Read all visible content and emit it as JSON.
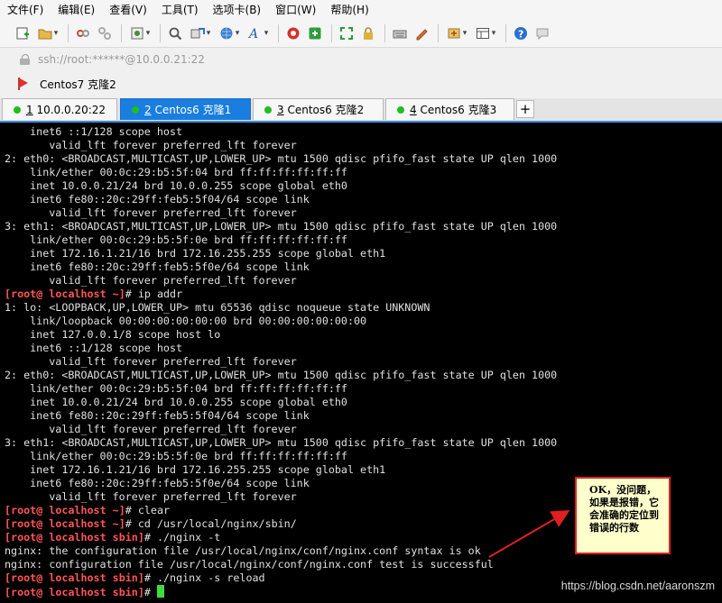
{
  "menu": [
    "文件(F)",
    "编辑(E)",
    "查看(V)",
    "工具(T)",
    "选项卡(B)",
    "窗口(W)",
    "帮助(H)"
  ],
  "address": "ssh://root:******@10.0.0.21:22",
  "session": "Centos7 克隆2",
  "tabs": [
    {
      "num": "1",
      "label": "10.0.0.20:22"
    },
    {
      "num": "2",
      "label": "Centos6 克隆1"
    },
    {
      "num": "3",
      "label": "Centos6 克隆2"
    },
    {
      "num": "4",
      "label": "Centos6 克隆3"
    }
  ],
  "active_tab_index": 1,
  "add_tab": "+",
  "prompt": {
    "user": "root",
    "host": "localhost"
  },
  "terminal_lines": [
    {
      "text": "    inet6 ::1/128 scope host "
    },
    {
      "text": "       valid_lft forever preferred_lft forever"
    },
    {
      "text": "2: eth0: <BROADCAST,MULTICAST,UP,LOWER_UP> mtu 1500 qdisc pfifo_fast state UP qlen 1000"
    },
    {
      "text": "    link/ether 00:0c:29:b5:5f:04 brd ff:ff:ff:ff:ff:ff"
    },
    {
      "text": "    inet 10.0.0.21/24 brd 10.0.0.255 scope global eth0"
    },
    {
      "text": "    inet6 fe80::20c:29ff:feb5:5f04/64 scope link "
    },
    {
      "text": "       valid_lft forever preferred_lft forever"
    },
    {
      "text": "3: eth1: <BROADCAST,MULTICAST,UP,LOWER_UP> mtu 1500 qdisc pfifo_fast state UP qlen 1000"
    },
    {
      "text": "    link/ether 00:0c:29:b5:5f:0e brd ff:ff:ff:ff:ff:ff"
    },
    {
      "text": "    inet 172.16.1.21/16 brd 172.16.255.255 scope global eth1"
    },
    {
      "text": "    inet6 fe80::20c:29ff:feb5:5f0e/64 scope link "
    },
    {
      "text": "       valid_lft forever preferred_lft forever"
    },
    {
      "cwd": "~",
      "cmd": "ip addr"
    },
    {
      "text": "1: lo: <LOOPBACK,UP,LOWER_UP> mtu 65536 qdisc noqueue state UNKNOWN "
    },
    {
      "text": "    link/loopback 00:00:00:00:00:00 brd 00:00:00:00:00:00"
    },
    {
      "text": "    inet 127.0.0.1/8 scope host lo"
    },
    {
      "text": "    inet6 ::1/128 scope host "
    },
    {
      "text": "       valid_lft forever preferred_lft forever"
    },
    {
      "text": "2: eth0: <BROADCAST,MULTICAST,UP,LOWER_UP> mtu 1500 qdisc pfifo_fast state UP qlen 1000"
    },
    {
      "text": "    link/ether 00:0c:29:b5:5f:04 brd ff:ff:ff:ff:ff:ff"
    },
    {
      "text": "    inet 10.0.0.21/24 brd 10.0.0.255 scope global eth0"
    },
    {
      "text": "    inet6 fe80::20c:29ff:feb5:5f04/64 scope link "
    },
    {
      "text": "       valid_lft forever preferred_lft forever"
    },
    {
      "text": "3: eth1: <BROADCAST,MULTICAST,UP,LOWER_UP> mtu 1500 qdisc pfifo_fast state UP qlen 1000"
    },
    {
      "text": "    link/ether 00:0c:29:b5:5f:0e brd ff:ff:ff:ff:ff:ff"
    },
    {
      "text": "    inet 172.16.1.21/16 brd 172.16.255.255 scope global eth1"
    },
    {
      "text": "    inet6 fe80::20c:29ff:feb5:5f0e/64 scope link "
    },
    {
      "text": "       valid_lft forever preferred_lft forever"
    },
    {
      "cwd": "~",
      "cmd": "clear"
    },
    {
      "cwd": "~",
      "cmd": "cd /usr/local/nginx/sbin/"
    },
    {
      "cwd": "sbin",
      "cmd": "./nginx -t"
    },
    {
      "text": "nginx: the configuration file /usr/local/nginx/conf/nginx.conf syntax is ok"
    },
    {
      "text": "nginx: configuration file /usr/local/nginx/conf/nginx.conf test is successful"
    },
    {
      "cwd": "sbin",
      "cmd": "./nginx -s reload"
    },
    {
      "cwd": "sbin",
      "cmd": "",
      "cursor": true
    }
  ],
  "annotation": "OK，没问题，如果是报错，它会准确的定位到错误的行数",
  "watermark": "https://blog.csdn.net/aaronszm",
  "colors": {
    "prompt": "#ff5555",
    "cursor": "#3ddc3d",
    "active_tab": "#1a7de0",
    "callout_border": "#e02020",
    "callout_bg": "#ffffcc"
  }
}
